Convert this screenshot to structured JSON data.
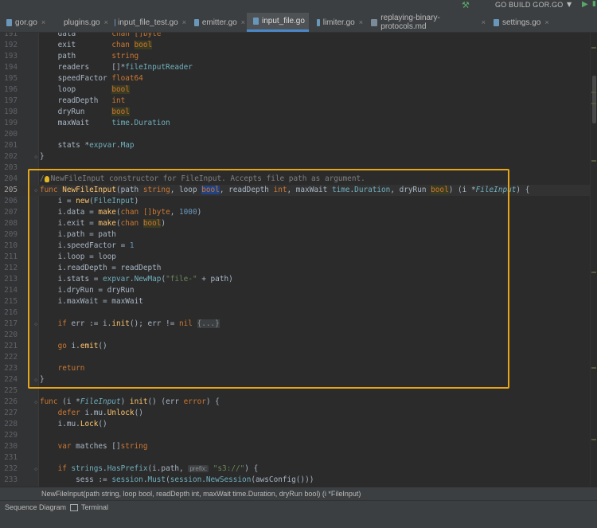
{
  "toolbar": {
    "run_config": "GO BUILD GOR.GO",
    "icons": [
      "hammer-icon",
      "chevron-down-icon",
      "run-icon",
      "more-icon"
    ]
  },
  "tabs": [
    {
      "label": "gor.go",
      "active": false
    },
    {
      "label": "plugins.go",
      "active": false
    },
    {
      "label": "input_file_test.go",
      "active": false
    },
    {
      "label": "emitter.go",
      "active": false
    },
    {
      "label": "input_file.go",
      "active": true
    },
    {
      "label": "limiter.go",
      "active": false
    },
    {
      "label": "replaying-binary-protocols.md",
      "active": false
    },
    {
      "label": "settings.go",
      "active": false
    }
  ],
  "code": {
    "current_line": "205",
    "lines": [
      {
        "n": "191",
        "segs": [
          {
            "t": "    data        "
          },
          {
            "t": "chan ",
            "c": "kw"
          },
          {
            "t": "[]byte",
            "c": "kw"
          }
        ]
      },
      {
        "n": "192",
        "segs": [
          {
            "t": "    exit        "
          },
          {
            "t": "chan ",
            "c": "kw"
          },
          {
            "t": "bool",
            "c": "bhl"
          }
        ]
      },
      {
        "n": "193",
        "segs": [
          {
            "t": "    path        "
          },
          {
            "t": "string",
            "c": "kw"
          }
        ]
      },
      {
        "n": "194",
        "segs": [
          {
            "t": "    readers     []*"
          },
          {
            "t": "fileInputReader",
            "c": "ty"
          }
        ]
      },
      {
        "n": "195",
        "segs": [
          {
            "t": "    speedFactor "
          },
          {
            "t": "float64",
            "c": "kw"
          }
        ]
      },
      {
        "n": "196",
        "segs": [
          {
            "t": "    loop        "
          },
          {
            "t": "bool",
            "c": "bhl"
          }
        ]
      },
      {
        "n": "197",
        "segs": [
          {
            "t": "    readDepth   "
          },
          {
            "t": "int",
            "c": "kw"
          }
        ]
      },
      {
        "n": "198",
        "segs": [
          {
            "t": "    dryRun      "
          },
          {
            "t": "bool",
            "c": "bhl"
          }
        ]
      },
      {
        "n": "199",
        "segs": [
          {
            "t": "    maxWait     "
          },
          {
            "t": "time",
            "c": "ty"
          },
          {
            "t": "."
          },
          {
            "t": "Duration",
            "c": "ty"
          }
        ]
      },
      {
        "n": "200",
        "segs": []
      },
      {
        "n": "201",
        "segs": [
          {
            "t": "    stats *"
          },
          {
            "t": "expvar",
            "c": "ty"
          },
          {
            "t": "."
          },
          {
            "t": "Map",
            "c": "ty"
          }
        ]
      },
      {
        "n": "202",
        "segs": [
          {
            "t": "}"
          }
        ]
      },
      {
        "n": "203",
        "segs": []
      },
      {
        "n": "204",
        "segs": [
          {
            "t": "/",
            "c": "cm"
          },
          {
            "t": "",
            "c": "bulb"
          },
          {
            "t": "NewFileInput constructor for FileInput. Accepts file path as argument.",
            "c": "cm"
          }
        ]
      },
      {
        "n": "205",
        "segs": [
          {
            "t": "func ",
            "c": "kw"
          },
          {
            "t": "NewFileInput",
            "c": "fn"
          },
          {
            "t": "(path "
          },
          {
            "t": "string",
            "c": "kw"
          },
          {
            "t": ", loop "
          },
          {
            "t": "bool",
            "c": "sel"
          },
          {
            "t": ", readDepth "
          },
          {
            "t": "int",
            "c": "kw"
          },
          {
            "t": ", maxWait "
          },
          {
            "t": "time",
            "c": "ty"
          },
          {
            "t": "."
          },
          {
            "t": "Duration",
            "c": "ty"
          },
          {
            "t": ", dryRun "
          },
          {
            "t": "bool",
            "c": "bhl"
          },
          {
            "t": ") (i *"
          },
          {
            "t": "FileInput",
            "c": "ity"
          },
          {
            "t": ") {"
          }
        ]
      },
      {
        "n": "206",
        "segs": [
          {
            "t": "    i = "
          },
          {
            "t": "new",
            "c": "fn"
          },
          {
            "t": "("
          },
          {
            "t": "FileInput",
            "c": "ty"
          },
          {
            "t": ")"
          }
        ]
      },
      {
        "n": "207",
        "segs": [
          {
            "t": "    i.data = "
          },
          {
            "t": "make",
            "c": "fn"
          },
          {
            "t": "("
          },
          {
            "t": "chan ",
            "c": "kw"
          },
          {
            "t": "[]byte",
            "c": "kw"
          },
          {
            "t": ", "
          },
          {
            "t": "1000",
            "c": "num"
          },
          {
            "t": ")"
          }
        ]
      },
      {
        "n": "208",
        "segs": [
          {
            "t": "    i.exit = "
          },
          {
            "t": "make",
            "c": "fn"
          },
          {
            "t": "("
          },
          {
            "t": "chan ",
            "c": "kw"
          },
          {
            "t": "bool",
            "c": "bhl"
          },
          {
            "t": ")"
          }
        ]
      },
      {
        "n": "209",
        "segs": [
          {
            "t": "    i.path = path"
          }
        ]
      },
      {
        "n": "210",
        "segs": [
          {
            "t": "    i.speedFactor = "
          },
          {
            "t": "1",
            "c": "num"
          }
        ]
      },
      {
        "n": "211",
        "segs": [
          {
            "t": "    i.loop = loop"
          }
        ]
      },
      {
        "n": "212",
        "segs": [
          {
            "t": "    i.readDepth = readDepth"
          }
        ]
      },
      {
        "n": "213",
        "segs": [
          {
            "t": "    i.stats = "
          },
          {
            "t": "expvar",
            "c": "ty"
          },
          {
            "t": "."
          },
          {
            "t": "NewMap",
            "c": "ty"
          },
          {
            "t": "("
          },
          {
            "t": "\"file-\"",
            "c": "str"
          },
          {
            "t": " + path)"
          }
        ]
      },
      {
        "n": "214",
        "segs": [
          {
            "t": "    i.dryRun = dryRun"
          }
        ]
      },
      {
        "n": "215",
        "segs": [
          {
            "t": "    i.maxWait = maxWait"
          }
        ]
      },
      {
        "n": "216",
        "segs": []
      },
      {
        "n": "217",
        "segs": [
          {
            "t": "    "
          },
          {
            "t": "if ",
            "c": "kw"
          },
          {
            "t": "err := i."
          },
          {
            "t": "init",
            "c": "fn"
          },
          {
            "t": "(); err != "
          },
          {
            "t": "nil",
            "c": "kw"
          },
          {
            "t": " "
          },
          {
            "t": "{...}",
            "c": "fold"
          }
        ]
      },
      {
        "n": "220",
        "segs": []
      },
      {
        "n": "221",
        "segs": [
          {
            "t": "    "
          },
          {
            "t": "go ",
            "c": "kw"
          },
          {
            "t": "i."
          },
          {
            "t": "emit",
            "c": "fn"
          },
          {
            "t": "()"
          }
        ]
      },
      {
        "n": "222",
        "segs": []
      },
      {
        "n": "223",
        "segs": [
          {
            "t": "    "
          },
          {
            "t": "return",
            "c": "kw"
          }
        ]
      },
      {
        "n": "224",
        "segs": [
          {
            "t": "}"
          }
        ]
      },
      {
        "n": "225",
        "segs": []
      },
      {
        "n": "226",
        "segs": [
          {
            "t": "func ",
            "c": "kw"
          },
          {
            "t": "(i *"
          },
          {
            "t": "FileInput",
            "c": "ity"
          },
          {
            "t": ") "
          },
          {
            "t": "init",
            "c": "fn"
          },
          {
            "t": "() (err "
          },
          {
            "t": "error",
            "c": "kw"
          },
          {
            "t": ") {"
          }
        ]
      },
      {
        "n": "227",
        "segs": [
          {
            "t": "    "
          },
          {
            "t": "defer ",
            "c": "kw"
          },
          {
            "t": "i.mu."
          },
          {
            "t": "Unlock",
            "c": "fn"
          },
          {
            "t": "()"
          }
        ]
      },
      {
        "n": "228",
        "segs": [
          {
            "t": "    i.mu."
          },
          {
            "t": "Lock",
            "c": "fn"
          },
          {
            "t": "()"
          }
        ]
      },
      {
        "n": "229",
        "segs": []
      },
      {
        "n": "230",
        "segs": [
          {
            "t": "    "
          },
          {
            "t": "var ",
            "c": "kw"
          },
          {
            "t": "matches []"
          },
          {
            "t": "string",
            "c": "kw"
          }
        ]
      },
      {
        "n": "231",
        "segs": []
      },
      {
        "n": "232",
        "segs": [
          {
            "t": "    "
          },
          {
            "t": "if ",
            "c": "kw"
          },
          {
            "t": "strings",
            "c": "ty"
          },
          {
            "t": "."
          },
          {
            "t": "HasPrefix",
            "c": "ty"
          },
          {
            "t": "(i.path, "
          },
          {
            "t": "prefix:",
            "c": "hint"
          },
          {
            "t": " "
          },
          {
            "t": "\"s3://\"",
            "c": "str"
          },
          {
            "t": ") {"
          }
        ]
      },
      {
        "n": "233",
        "segs": [
          {
            "t": "        sess := "
          },
          {
            "t": "session",
            "c": "ty"
          },
          {
            "t": "."
          },
          {
            "t": "Must",
            "c": "ty"
          },
          {
            "t": "("
          },
          {
            "t": "session",
            "c": "ty"
          },
          {
            "t": "."
          },
          {
            "t": "NewSession",
            "c": "ty"
          },
          {
            "t": "(awsConfig()))"
          }
        ]
      }
    ]
  },
  "signature_hint": "NewFileInput(path string, loop bool, readDepth int, maxWait time.Duration, dryRun bool) (i *FileInput)",
  "tool_windows": [
    {
      "label": "Sequence Diagram",
      "icon": ""
    },
    {
      "label": "Terminal",
      "icon": "terminal-icon"
    }
  ]
}
